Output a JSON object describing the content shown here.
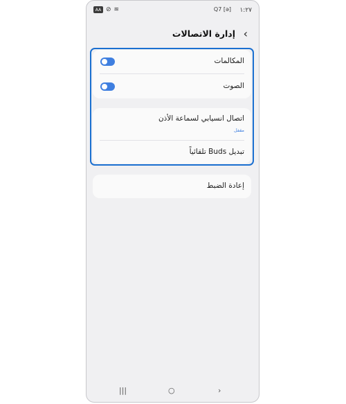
{
  "status_bar": {
    "time": "١:٢٧",
    "right_icons": "Q7 [ə] ",
    "app_badge": "AA",
    "mute_icon": "⊘",
    "wifi_icon": "≋"
  },
  "header": {
    "title": "إدارة الاتصالات",
    "back_icon": "‹"
  },
  "group1": {
    "calls_label": "المكالمات",
    "calls_on": true,
    "audio_label": "الصوت",
    "audio_on": true
  },
  "group2": {
    "seamless_label": "اتصال انسيابي لسماعة الأذن",
    "seamless_status": "مقفل",
    "auto_switch_label": "تبديل Buds تلقائياً"
  },
  "group3": {
    "reset_label": "إعادة الضبط"
  },
  "navbar": {
    "recents": "|||",
    "home": "○",
    "back": "›"
  },
  "colors": {
    "accent": "#3f7fe0",
    "highlight": "#1a6fd0",
    "background": "#f0f0f2"
  }
}
